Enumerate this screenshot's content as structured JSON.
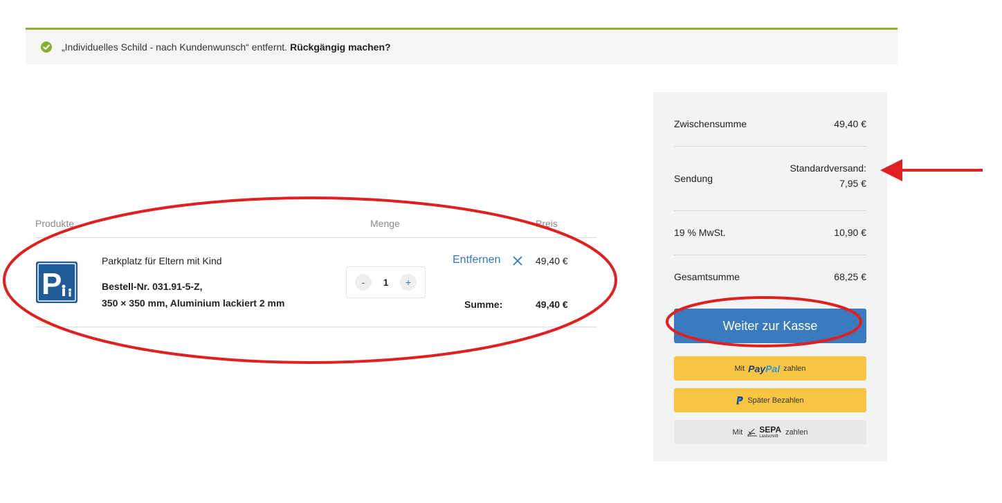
{
  "notice": {
    "message": "„Individuelles Schild - nach Kundenwunsch“ entfernt.",
    "undo_label": "Rückgängig machen?"
  },
  "cart": {
    "headers": {
      "products": "Produkte",
      "quantity": "Menge",
      "price": "Preis"
    },
    "item": {
      "name": "Parkplatz für Eltern mit Kind",
      "sku": "Bestell-Nr. 031.91-5-Z,",
      "details": "350 × 350 mm, Aluminium lackiert 2 mm",
      "quantity": "1",
      "qty_minus": "-",
      "qty_plus": "+",
      "remove_label": "Entfernen",
      "price": "49,40 €",
      "sum_label": "Summe:",
      "sum_value": "49,40 €"
    }
  },
  "totals": {
    "subtotal_label": "Zwischensumme",
    "subtotal_value": "49,40 €",
    "shipping_label": "Sendung",
    "shipping_method": "Standardversand:",
    "shipping_value": "7,95 €",
    "tax_label": "19 % MwSt.",
    "tax_value": "10,90 €",
    "total_label": "Gesamtsumme",
    "total_value": "68,25 €"
  },
  "checkout": {
    "button_label": "Weiter zur Kasse",
    "paypal_prefix": "Mit",
    "paypal_brand_a": "Pay",
    "paypal_brand_b": "Pal",
    "paypal_suffix": "zahlen",
    "paylater_label": "Später Bezahlen",
    "sepa_prefix": "Mit",
    "sepa_brand": "SEPA",
    "sepa_sub": "Lastschrift",
    "sepa_suffix": "zahlen"
  },
  "colors": {
    "accent_blue": "#3a7bbf",
    "notice_border": "#8ab02e",
    "paypal_yellow": "#f7c542",
    "annotation_red": "#e02020"
  }
}
